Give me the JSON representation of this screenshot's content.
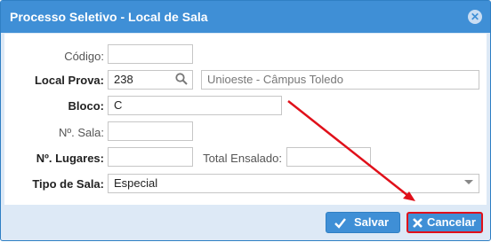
{
  "dialog": {
    "title": "Processo Seletivo - Local de Sala",
    "close_icon": "close-circle-icon"
  },
  "form": {
    "codigo": {
      "label": "Código:",
      "value": ""
    },
    "local_prova": {
      "label": "Local Prova:",
      "code": "238",
      "name": "Unioeste - Câmpus Toledo",
      "search_icon": "search-icon"
    },
    "bloco": {
      "label": "Bloco:",
      "value": "C"
    },
    "sala": {
      "label": "Nº. Sala:",
      "value": ""
    },
    "lugares": {
      "label": "Nº. Lugares:",
      "value": ""
    },
    "total_ensalado": {
      "label": "Total Ensalado:",
      "value": ""
    },
    "tipo_sala": {
      "label": "Tipo de Sala:",
      "selected": "Especial"
    }
  },
  "buttons": {
    "save": {
      "label": "Salvar",
      "icon": "check-icon"
    },
    "cancel": {
      "label": "Cancelar",
      "icon": "close-x-icon"
    }
  },
  "colors": {
    "header": "#3f8fd6",
    "highlight": "#e0101a"
  }
}
